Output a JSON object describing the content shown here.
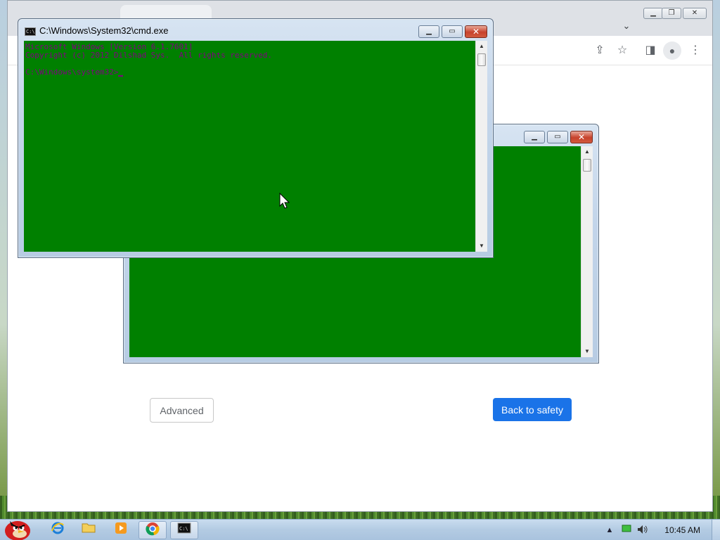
{
  "browser": {
    "tab_search_icon": "chevron-down-icon",
    "toolbar_icons": [
      "share-icon",
      "star-icon",
      "side-panel-icon",
      "profile-icon",
      "menu-icon"
    ],
    "advanced_label": "Advanced",
    "back_label": "Back to safety",
    "accent": "#1a73e8"
  },
  "cmd_front": {
    "title": "C:\\Windows\\System32\\cmd.exe",
    "lines": [
      "Microsoft Windows [Version 6.1.7601]",
      "Copyright (c) 2012 Dilshad Sys.  All rights reserved.",
      "",
      "C:\\Windows\\system32>"
    ],
    "bg_color": "#008000",
    "text_color": "#800080"
  },
  "cmd_back": {
    "title": "",
    "bg_color": "#008000"
  },
  "taskbar": {
    "apps": [
      "angry-bird-start-icon",
      "internet-explorer-icon",
      "folder-icon",
      "media-player-icon",
      "chrome-icon",
      "cmd-icon"
    ],
    "clock": "10:45 AM",
    "tray": [
      "show-hidden-icons-icon",
      "network-icon",
      "volume-icon"
    ]
  }
}
